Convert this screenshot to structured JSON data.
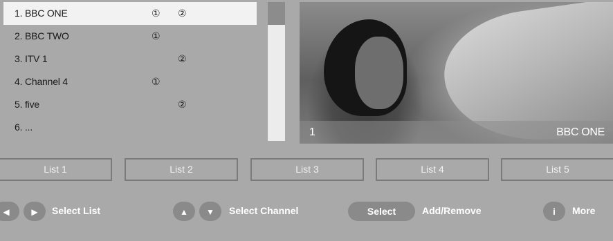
{
  "channels": [
    {
      "label": "1. BBC ONE",
      "list1": "①",
      "list2": "②",
      "selected": true
    },
    {
      "label": "2. BBC TWO",
      "list1": "①",
      "list2": ""
    },
    {
      "label": "3. ITV 1",
      "list1": "",
      "list2": "②"
    },
    {
      "label": "4. Channel 4",
      "list1": "①",
      "list2": ""
    },
    {
      "label": "5. five",
      "list1": "",
      "list2": "②"
    },
    {
      "label": "6. ...",
      "list1": "",
      "list2": ""
    }
  ],
  "preview": {
    "channel_number": "1",
    "channel_name": "BBC ONE"
  },
  "tabs": [
    "List 1",
    "List 2",
    "List 3",
    "List 4",
    "List 5"
  ],
  "help": {
    "left_icon": "◀",
    "right_icon": "▶",
    "select_list": "Select List",
    "up_icon": "▲",
    "down_icon": "▼",
    "select_channel": "Select Channel",
    "select_key": "Select",
    "add_remove": "Add/Remove",
    "info_key": "i",
    "more": "More"
  },
  "colors": {
    "background": "#a9a9a9",
    "selected_row": "#f2f2f2",
    "scrollbar": "#ececec",
    "scroll_thumb": "#8c8c8c"
  }
}
